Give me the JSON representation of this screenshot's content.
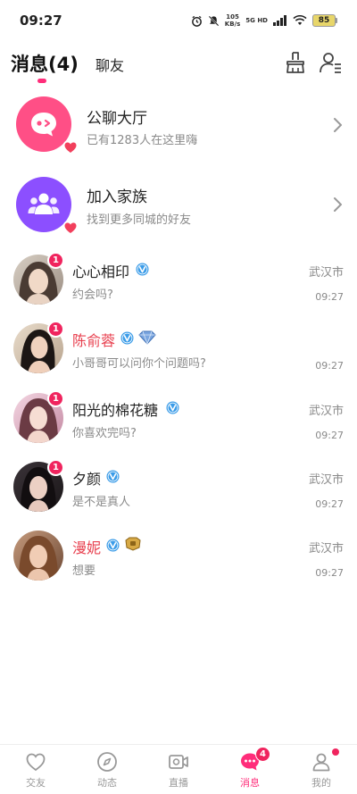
{
  "status_bar": {
    "time": "09:27",
    "net_speed_value": "105",
    "net_speed_unit": "KB/s",
    "network": "5G HD",
    "battery": "85"
  },
  "header": {
    "messages_tab": "消息(4)",
    "chat_tab": "聊友"
  },
  "groups": [
    {
      "title": "公聊大厅",
      "subtitle": "已有1283人在这里嗨"
    },
    {
      "title": "加入家族",
      "subtitle": "找到更多同城的好友"
    }
  ],
  "conversations": [
    {
      "name": "心心相印",
      "unread": "1",
      "message": "约会吗?",
      "city": "武汉市",
      "time": "09:27"
    },
    {
      "name": "陈俞蓉",
      "unread": "1",
      "message": "小哥哥可以问你个问题吗?",
      "city": "",
      "time": "09:27"
    },
    {
      "name": "阳光的棉花糖",
      "unread": "1",
      "message": "你喜欢完吗?",
      "city": "武汉市",
      "time": "09:27"
    },
    {
      "name": "夕颜",
      "unread": "1",
      "message": "是不是真人",
      "city": "武汉市",
      "time": "09:27"
    },
    {
      "name": "漫妮",
      "unread": "",
      "message": "想要",
      "city": "武汉市",
      "time": "09:27"
    }
  ],
  "bottom_nav": {
    "items": [
      {
        "label": "交友",
        "icon": "heart-icon"
      },
      {
        "label": "动态",
        "icon": "compass-icon"
      },
      {
        "label": "直播",
        "icon": "video-icon"
      },
      {
        "label": "消息",
        "icon": "chat-icon",
        "badge": "4"
      },
      {
        "label": "我的",
        "icon": "person-icon"
      }
    ],
    "active": "消息"
  },
  "colors": {
    "accent": "#ff2d7a",
    "badge": "#f0245e",
    "public_chat_avatar": "#ff4f86",
    "family_avatar": "#8c4fff",
    "verified": "#3b9ce8"
  }
}
